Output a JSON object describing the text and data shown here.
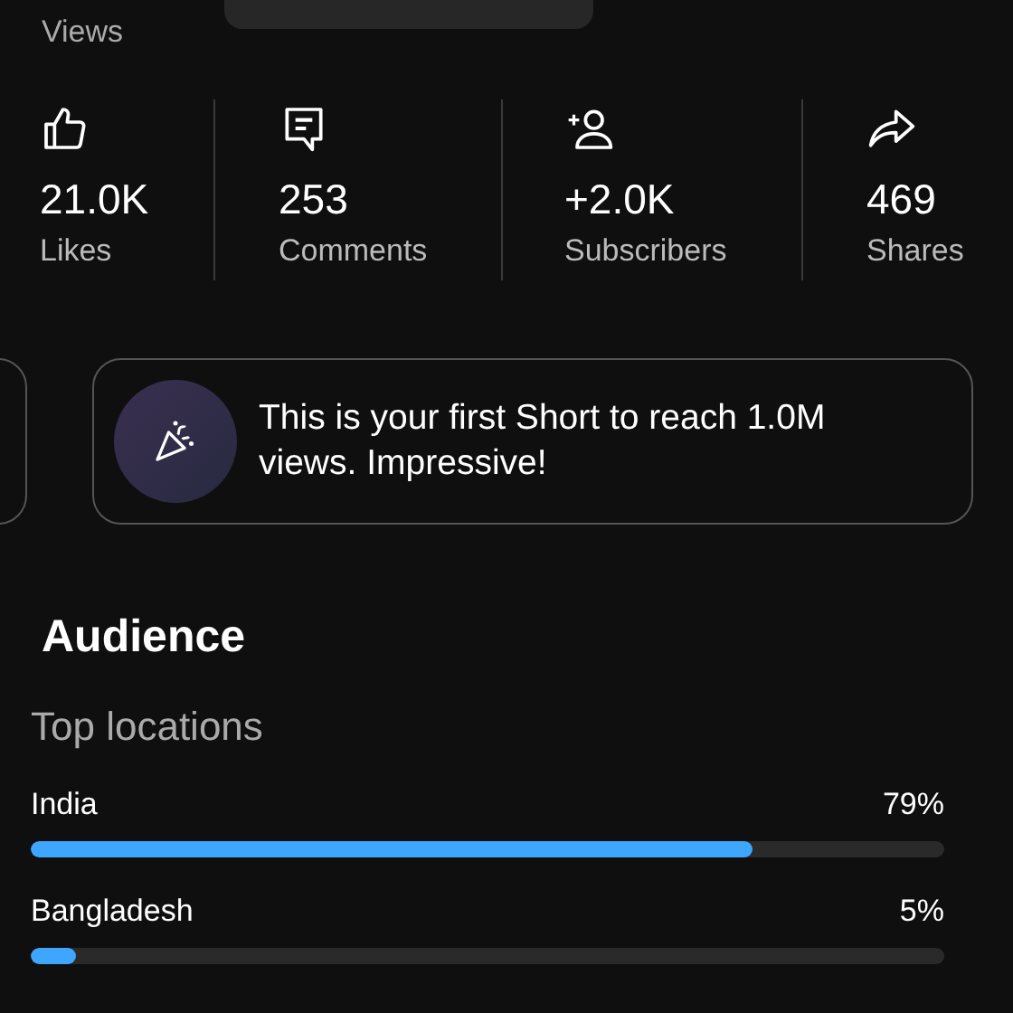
{
  "views_label": "Views",
  "stats": [
    {
      "kind": "likes",
      "value": "21.0K",
      "label": "Likes"
    },
    {
      "kind": "comments",
      "value": "253",
      "label": "Comments"
    },
    {
      "kind": "subscribers",
      "value": "+2.0K",
      "label": "Subscribers"
    },
    {
      "kind": "shares",
      "value": "469",
      "label": "Shares"
    }
  ],
  "milestone": {
    "text": "This is your first Short to reach 1.0M views. Impressive!"
  },
  "audience": {
    "title": "Audience",
    "subtitle": "Top locations",
    "locations": [
      {
        "name": "India",
        "reading": "79%",
        "level": 0.79
      },
      {
        "name": "Bangladesh",
        "reading": "5%",
        "level": 0.05
      }
    ]
  }
}
